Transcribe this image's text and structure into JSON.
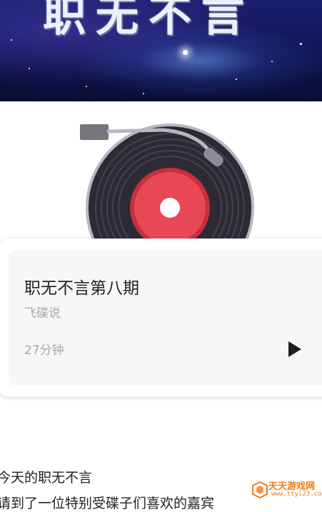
{
  "banner": {
    "title": "职无不言"
  },
  "episode": {
    "title": "职无不言第八期",
    "author": "飞碟说",
    "duration": "27分钟"
  },
  "description": {
    "line1": "今天的职无不言",
    "line2": "请到了一位特别受碟子们喜欢的嘉宾"
  },
  "watermark": {
    "name": "天天游戏网",
    "url": "www.ttyl23.com"
  },
  "icons": {
    "play": "play-icon",
    "record": "vinyl-record-icon",
    "tonearm": "tonearm-icon",
    "watermark_logo": "watermark-logo-icon"
  },
  "colors": {
    "record_label": "#e84855",
    "record_body": "#2d2a35",
    "record_rim": "#b9b6c2",
    "banner_bg": "#101552",
    "watermark": "#f07a1a"
  }
}
